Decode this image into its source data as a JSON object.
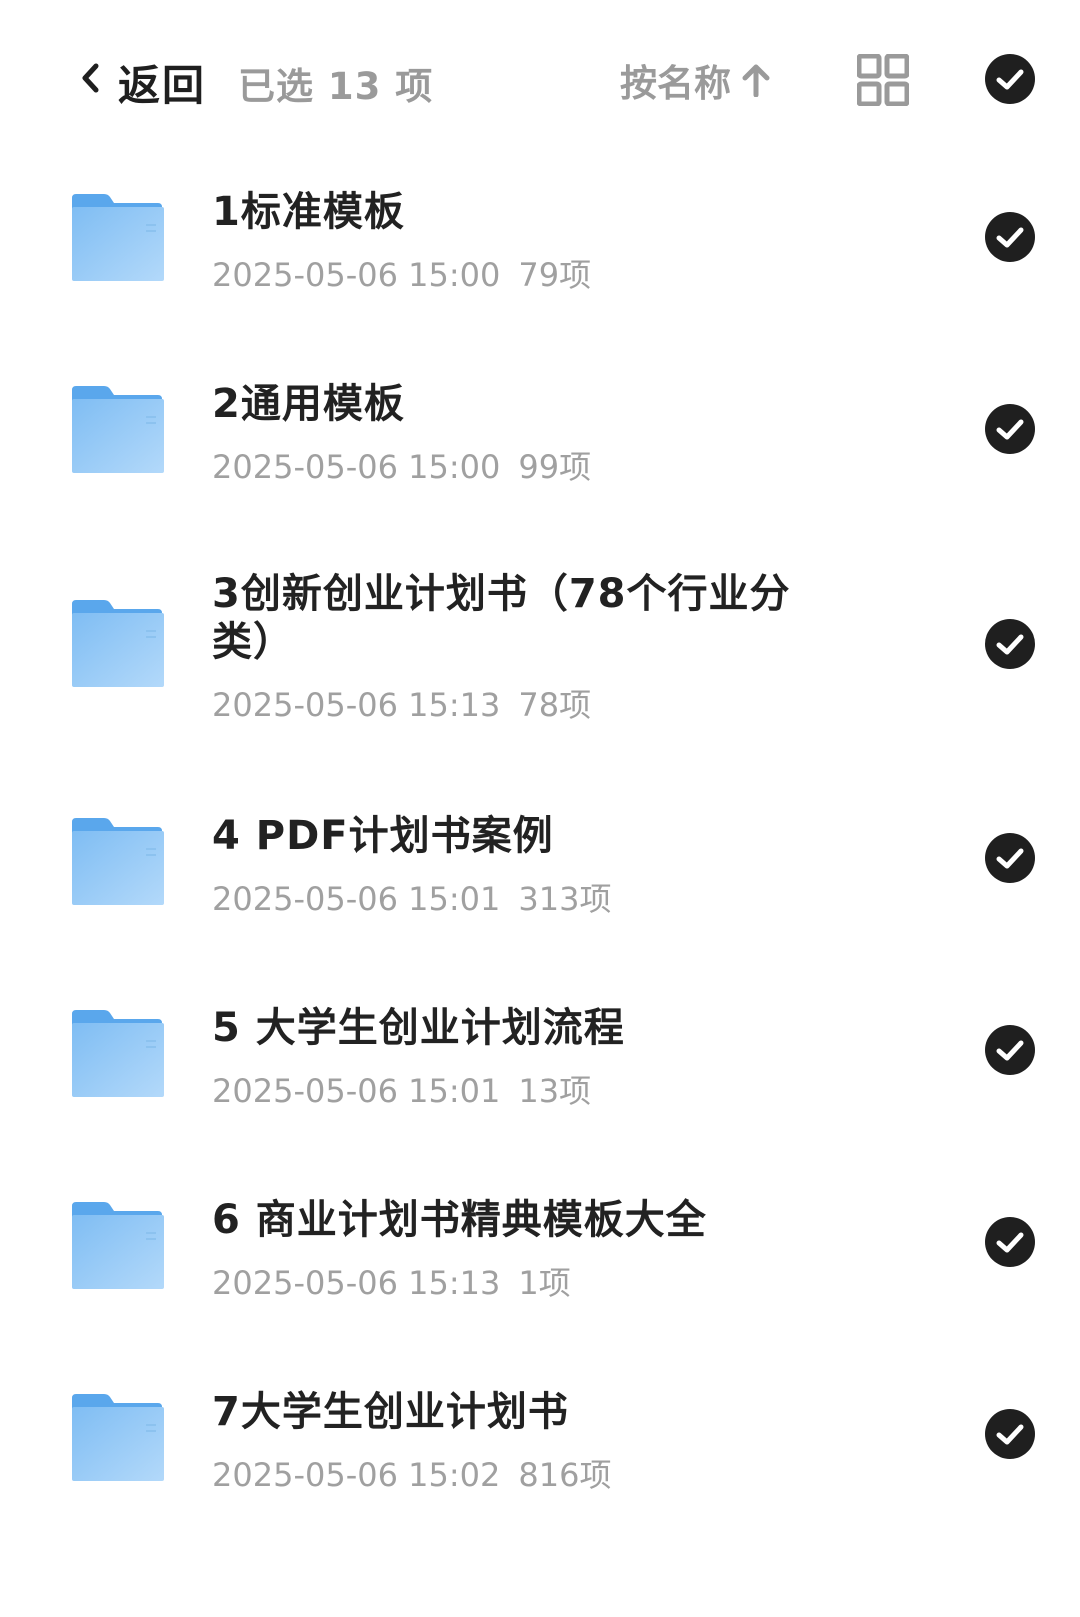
{
  "header": {
    "back_label": "返回",
    "selected_label": "已选 13 项",
    "sort_label": "按名称",
    "sort_icon": "arrow-up-icon",
    "view_icon": "grid-view-icon",
    "select_all_icon": "check-circle-icon"
  },
  "files": [
    {
      "name": "1标准模板",
      "date": "2025-05-06 15:00",
      "count": "79项"
    },
    {
      "name": "2通用模板",
      "date": "2025-05-06 15:00",
      "count": "99项"
    },
    {
      "name": "3创新创业计划书（78个行业分类）",
      "date": "2025-05-06 15:13",
      "count": "78项"
    },
    {
      "name": "4 PDF计划书案例",
      "date": "2025-05-06 15:01",
      "count": "313项"
    },
    {
      "name": "5 大学生创业计划流程",
      "date": "2025-05-06 15:01",
      "count": "13项"
    },
    {
      "name": "6 商业计划书精典模板大全",
      "date": "2025-05-06 15:13",
      "count": "1项"
    },
    {
      "name": "7大学生创业计划书",
      "date": "2025-05-06 15:02",
      "count": "816项"
    }
  ],
  "colors": {
    "folder_back": "#5aa7ec",
    "folder_front": "#9ccdf7",
    "check_bg": "#1f1f1f",
    "muted_text": "#9a9a9a"
  }
}
